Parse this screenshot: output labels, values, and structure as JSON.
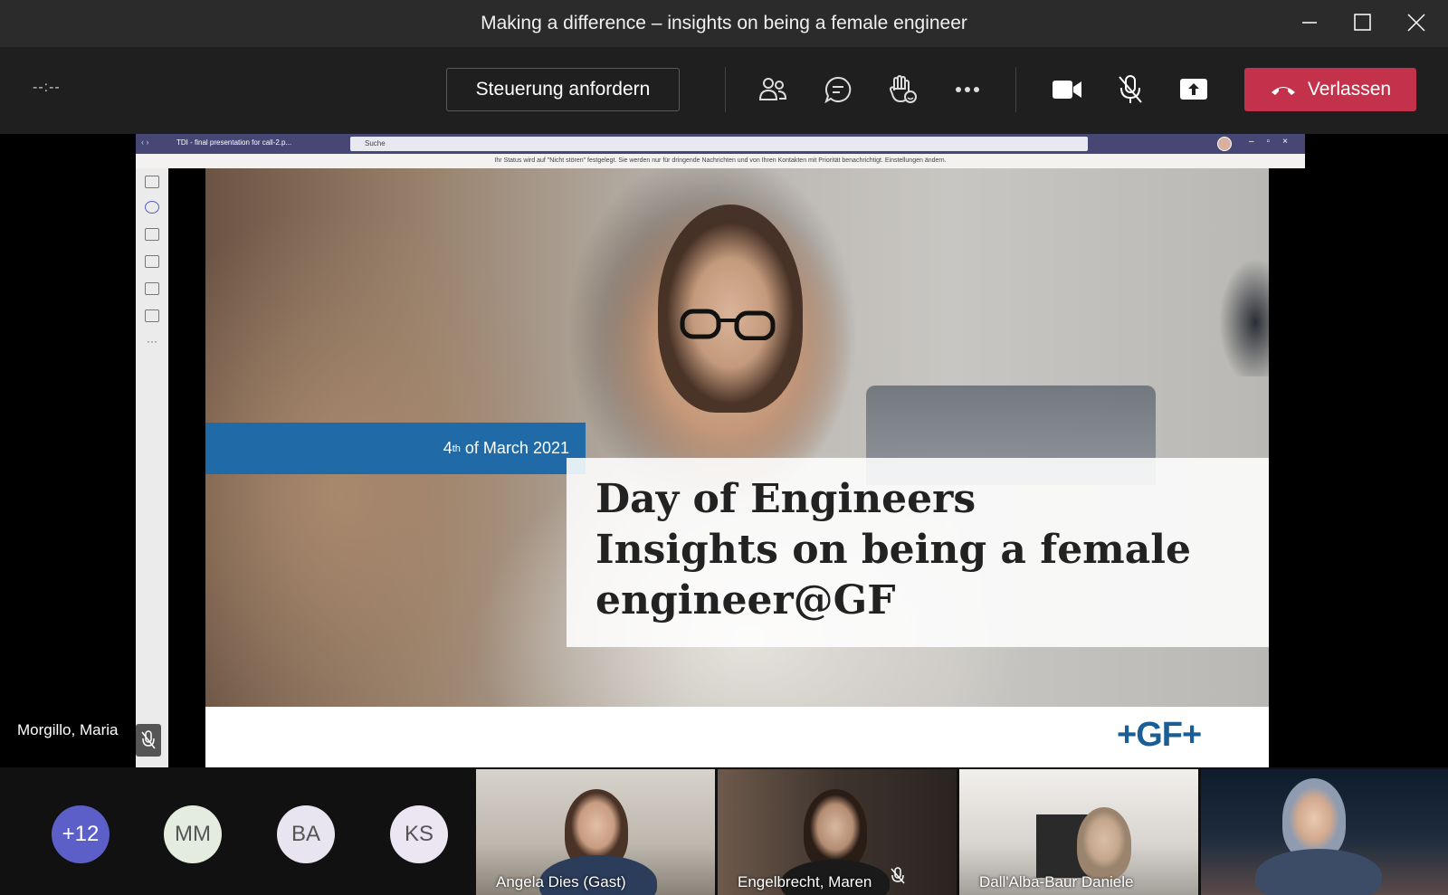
{
  "window": {
    "title": "Making a difference – insights on being a female engineer"
  },
  "toolbar": {
    "timer": "--:--",
    "request_control_label": "Steuerung anfordern",
    "leave_label": "Verlassen",
    "icons": [
      "participants-icon",
      "chat-icon",
      "raise-hand-icon",
      "more-options-icon",
      "camera-icon",
      "mic-muted-icon",
      "share-screen-icon",
      "hang-up-icon"
    ]
  },
  "shared_screen": {
    "tab_title": "TDI - final presentation for call-2.p...",
    "search_placeholder": "Suche",
    "banner": "Ihr Status wird auf \"Nicht stören\" festgelegt. Sie werden nur für dringende Nachrichten und von Ihren Kontakten mit Priorität benachrichtigt. Einstellungen ändern.",
    "slide": {
      "date_day": "4",
      "date_suffix": "th",
      "date_rest": " of March 2021",
      "title_line1": "Day of Engineers",
      "title_line2": "Insights on being a female",
      "title_line3": "engineer@GF",
      "logo": "+GF+"
    }
  },
  "presenter": {
    "name": "Morgillo, Maria"
  },
  "participants": {
    "overflow": "+12",
    "avatars": [
      {
        "initials": "MM",
        "bg": "#e4ece0"
      },
      {
        "initials": "BA",
        "bg": "#e8e4f0"
      },
      {
        "initials": "KS",
        "bg": "#ece6f2"
      }
    ],
    "videos": [
      {
        "name": "Angela Dies (Gast)"
      },
      {
        "name": "Engelbrecht, Maren"
      },
      {
        "name": "Dall'Alba-Baur Daniele"
      }
    ]
  },
  "colors": {
    "leave": "#c4314b",
    "overflow_avatar": "#5b5fc7",
    "slide_band": "#1f6aa7",
    "logo": "#1b5e95"
  }
}
